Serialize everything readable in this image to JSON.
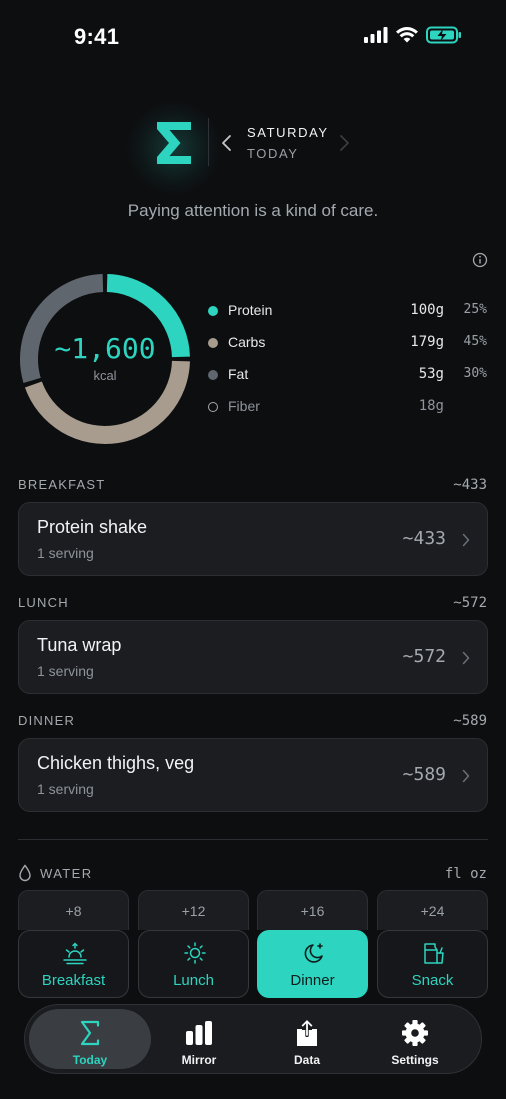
{
  "status_bar": {
    "time": "9:41"
  },
  "header": {
    "logo_glyph": "Σ",
    "day": "SATURDAY",
    "day_sub": "TODAY",
    "tagline": "Paying attention is a kind of care."
  },
  "summary": {
    "kcal": "~1,600",
    "kcal_unit": "kcal",
    "macros": [
      {
        "name": "Protein",
        "grams": "100g",
        "pct": "25%",
        "color": "#2dd4bf",
        "share": 0.25
      },
      {
        "name": "Carbs",
        "grams": "179g",
        "pct": "45%",
        "color": "#a89c8f",
        "share": 0.45
      },
      {
        "name": "Fat",
        "grams": "53g",
        "pct": "30%",
        "color": "#5f666e",
        "share": 0.3
      },
      {
        "name": "Fiber",
        "grams": "18g",
        "pct": "",
        "color": "#8e949a"
      }
    ]
  },
  "meals": [
    {
      "section": "BREAKFAST",
      "total": "~433",
      "title": "Protein shake",
      "serving": "1 serving",
      "cal": "~433"
    },
    {
      "section": "LUNCH",
      "total": "~572",
      "title": "Tuna wrap",
      "serving": "1 serving",
      "cal": "~572"
    },
    {
      "section": "DINNER",
      "total": "~589",
      "title": "Chicken thighs, veg",
      "serving": "1 serving",
      "cal": "~589"
    }
  ],
  "water": {
    "label": "WATER",
    "unit": "fl oz",
    "buttons": [
      "+8",
      "+12",
      "+16",
      "+24"
    ]
  },
  "meal_types": [
    {
      "label": "Breakfast",
      "icon": "sunrise-icon",
      "active": false
    },
    {
      "label": "Lunch",
      "icon": "sun-icon",
      "active": false
    },
    {
      "label": "Dinner",
      "icon": "moon-icon",
      "active": true
    },
    {
      "label": "Snack",
      "icon": "snack-icon",
      "active": false
    }
  ],
  "tabs": [
    {
      "label": "Today",
      "icon": "sigma-icon",
      "active": true
    },
    {
      "label": "Mirror",
      "icon": "bars-icon",
      "active": false
    },
    {
      "label": "Data",
      "icon": "export-icon",
      "active": false
    },
    {
      "label": "Settings",
      "icon": "gear-icon",
      "active": false
    }
  ],
  "colors": {
    "accent": "#2dd4bf",
    "background": "#0d0e10",
    "card": "#1b1d20"
  }
}
